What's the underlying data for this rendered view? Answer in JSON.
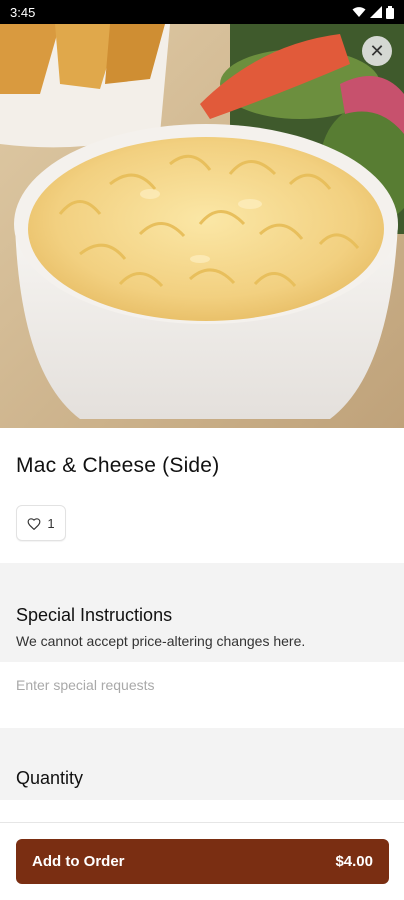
{
  "status_bar": {
    "time": "3:45"
  },
  "item": {
    "title": "Mac & Cheese (Side)",
    "likes": "1"
  },
  "special_instructions": {
    "title": "Special Instructions",
    "subtitle": "We cannot accept price-altering changes here.",
    "placeholder": "Enter special requests"
  },
  "quantity": {
    "title": "Quantity"
  },
  "footer": {
    "button_label": "Add to Order",
    "price": "$4.00"
  },
  "colors": {
    "accent": "#7a2e12",
    "section_bg": "#f3f3f3"
  },
  "icons": [
    "wifi-icon",
    "signal-icon",
    "battery-icon",
    "close-icon",
    "heart-icon"
  ]
}
